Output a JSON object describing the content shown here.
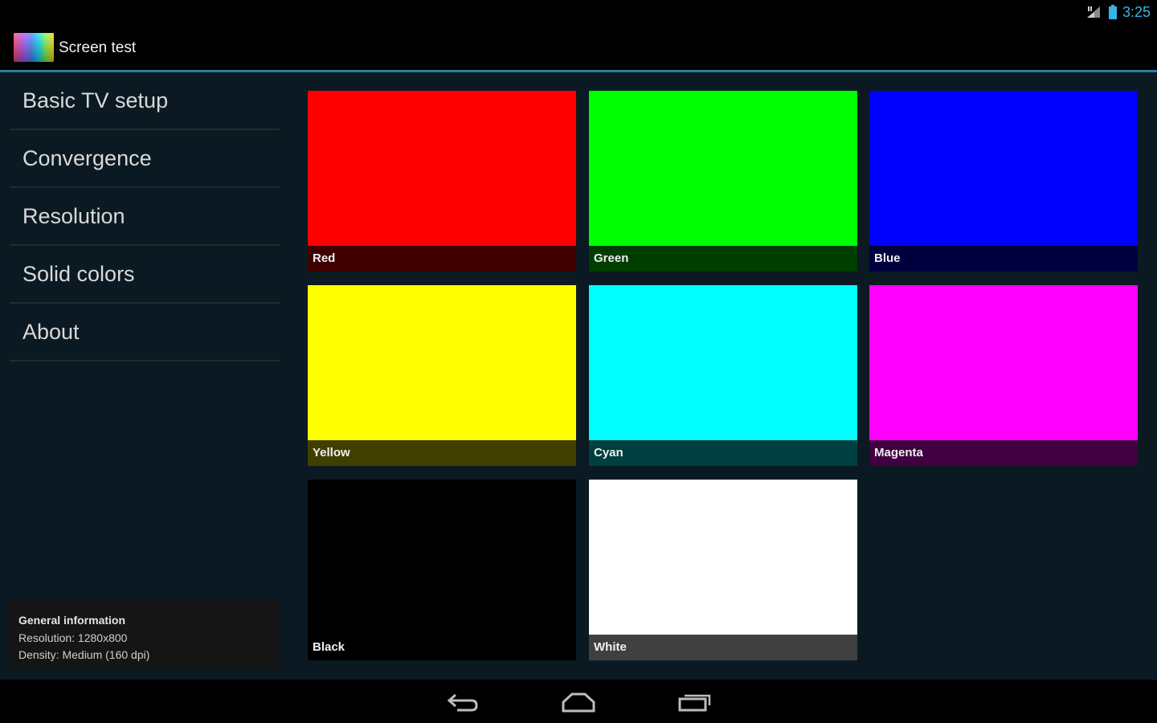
{
  "status_bar": {
    "time": "3:25",
    "icons": [
      "signal-icon",
      "battery-icon"
    ]
  },
  "action_bar": {
    "title": "Screen test",
    "app_icon": "rainbow-gradient-icon"
  },
  "sidebar": {
    "items": [
      {
        "label": "Basic TV setup"
      },
      {
        "label": "Convergence"
      },
      {
        "label": "Resolution"
      },
      {
        "label": "Solid colors"
      },
      {
        "label": "About"
      }
    ]
  },
  "info": {
    "title": "General information",
    "resolution": "Resolution: 1280x800",
    "density": "Density: Medium (160 dpi)"
  },
  "tiles": [
    {
      "label": "Red",
      "color": "#ff0000",
      "label_bg": "#400000"
    },
    {
      "label": "Green",
      "color": "#00ff00",
      "label_bg": "#003e00"
    },
    {
      "label": "Blue",
      "color": "#0000ff",
      "label_bg": "#00003f"
    },
    {
      "label": "Yellow",
      "color": "#ffff00",
      "label_bg": "#413f00"
    },
    {
      "label": "Cyan",
      "color": "#00ffff",
      "label_bg": "#003f3f"
    },
    {
      "label": "Magenta",
      "color": "#ff00ff",
      "label_bg": "#40003f"
    },
    {
      "label": "Black",
      "color": "#000000",
      "label_bg": "#000000"
    },
    {
      "label": "White",
      "color": "#ffffff",
      "label_bg": "#404040"
    }
  ],
  "theme": {
    "accent": "#33b5e5",
    "background": "#0b1a22"
  },
  "nav_bar": {
    "buttons": [
      "back-icon",
      "home-icon",
      "recent-apps-icon"
    ]
  }
}
